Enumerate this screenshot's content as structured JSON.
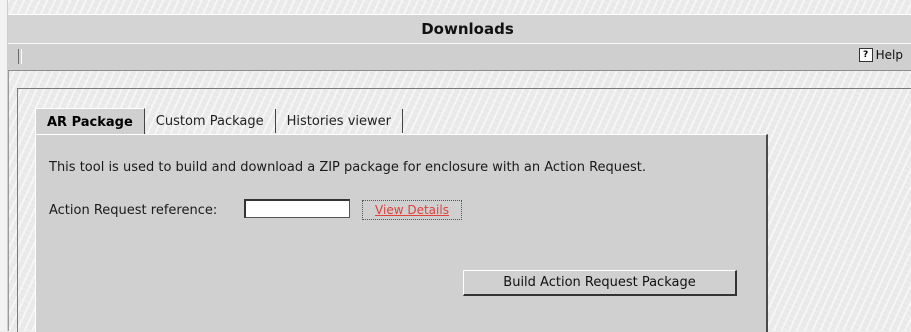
{
  "header": {
    "title": "Downloads"
  },
  "toolbar": {
    "help_label": "Help",
    "help_icon": "help-icon"
  },
  "tabs": [
    {
      "label": "AR Package",
      "active": true
    },
    {
      "label": "Custom Package",
      "active": false
    },
    {
      "label": "Histories viewer",
      "active": false
    }
  ],
  "panel": {
    "description": "This tool is used to build and download a ZIP package for enclosure with an Action Request.",
    "reference_label": "Action Request reference:",
    "reference_value": "",
    "view_details_label": "View Details",
    "build_button_label": "Build Action Request Package"
  },
  "colors": {
    "link": "#e0413a",
    "panel": "#d0d0d0",
    "title_bar": "#d4d4d4"
  }
}
